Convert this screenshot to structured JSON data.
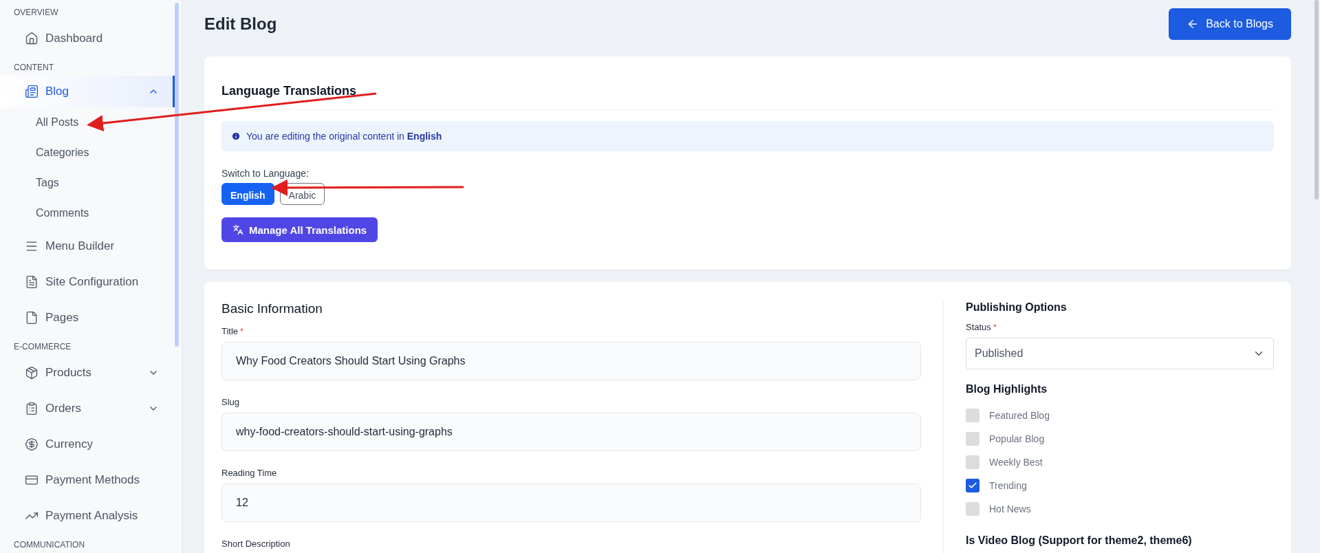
{
  "sidebar": {
    "sections": [
      {
        "title": "OVERVIEW",
        "items": [
          {
            "label": "Dashboard",
            "selected": false
          }
        ]
      },
      {
        "title": "CONTENT",
        "items": [
          {
            "label": "Blog",
            "selected": true,
            "expanded": true,
            "children": [
              {
                "label": "All Posts",
                "selected": false
              },
              {
                "label": "Categories",
                "selected": false
              },
              {
                "label": "Tags",
                "selected": false
              },
              {
                "label": "Comments",
                "selected": false
              }
            ]
          },
          {
            "label": "Menu Builder",
            "selected": false
          },
          {
            "label": "Site Configuration",
            "selected": false
          },
          {
            "label": "Pages",
            "selected": false
          }
        ]
      },
      {
        "title": "E-COMMERCE",
        "items": [
          {
            "label": "Products",
            "selected": false,
            "expanded": false
          },
          {
            "label": "Orders",
            "selected": false,
            "expanded": false
          },
          {
            "label": "Currency",
            "selected": false
          },
          {
            "label": "Payment Methods",
            "selected": false
          },
          {
            "label": "Payment Analysis",
            "selected": false
          }
        ]
      },
      {
        "title": "COMMUNICATION"
      }
    ]
  },
  "page": {
    "title": "Edit Blog",
    "back_button": "Back to Blogs"
  },
  "translations": {
    "title": "Language Translations",
    "notice": "You are editing the original content in **English**",
    "switch_label": "Switch to Language:",
    "languages": [
      {
        "label": "English",
        "selected": true
      },
      {
        "label": "Arabic",
        "selected": false
      }
    ],
    "manage_button": "Manage All Translations"
  },
  "basic_info": {
    "title": "Basic Information",
    "fields": [
      {
        "label": "Title",
        "required_mark": "*",
        "value": "Why Food Creators Should Start Using Graphs"
      },
      {
        "label": "Slug",
        "value": "why-food-creators-should-start-using-graphs"
      },
      {
        "label": "Reading Time",
        "value": "12"
      },
      {
        "label": "Short Description"
      }
    ]
  },
  "publishing": {
    "title": "Publishing Options",
    "status_label": "Status",
    "status_required_mark": "*",
    "status_value": "Published",
    "highlights_title": "Blog Highlights",
    "highlights": [
      {
        "label": "Featured Blog",
        "checked": false
      },
      {
        "label": "Popular Blog",
        "checked": false
      },
      {
        "label": "Weekly Best",
        "checked": false
      },
      {
        "label": "Trending",
        "checked": true
      },
      {
        "label": "Hot News",
        "checked": false
      }
    ],
    "video_title": "Is Video Blog (Support for theme2, theme6)"
  }
}
